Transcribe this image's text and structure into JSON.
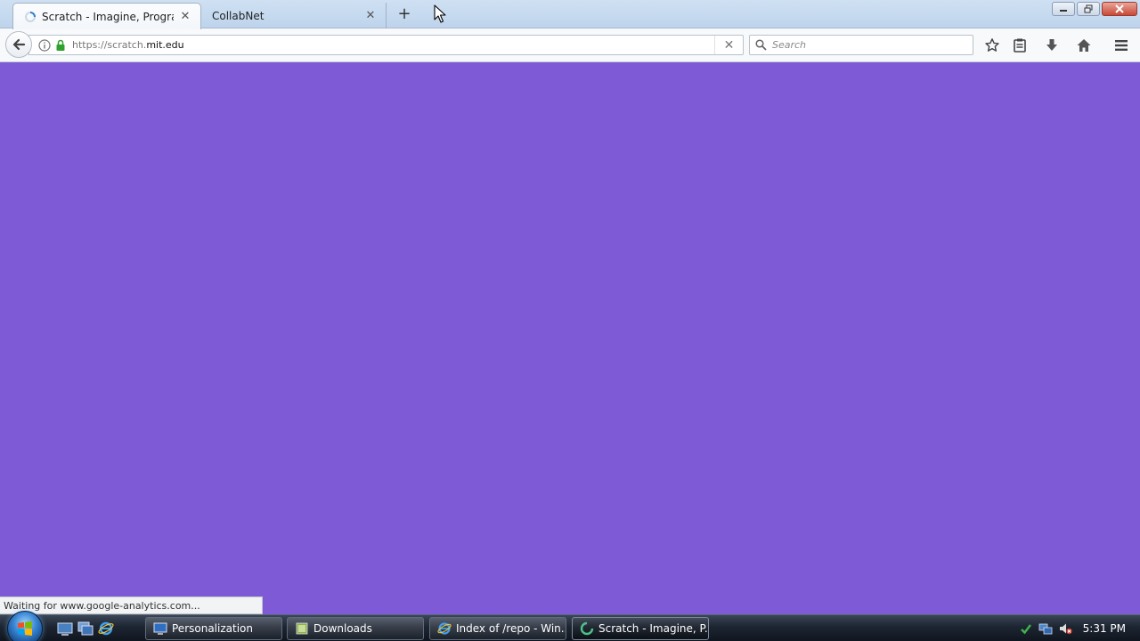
{
  "browser": {
    "tabs": [
      {
        "title": "Scratch - Imagine, Program",
        "active": true
      },
      {
        "title": "CollabNet",
        "active": false
      }
    ],
    "new_tab_label": "+",
    "url_prefix": "https://scratch.",
    "url_domain": "mit.edu",
    "search_placeholder": "Search",
    "status_text": "Waiting for www.google-analytics.com..."
  },
  "page": {
    "background_color": "#7e5ad6"
  },
  "taskbar": {
    "items": [
      {
        "label": "Personalization",
        "icon": "monitor-icon"
      },
      {
        "label": "Downloads",
        "icon": "folder-icon"
      },
      {
        "label": "Index of /repo - Win...",
        "icon": "ie-icon"
      },
      {
        "label": "Scratch - Imagine, P...",
        "icon": "firefox-loading-icon",
        "active": true
      }
    ],
    "clock": "5:31 PM"
  }
}
